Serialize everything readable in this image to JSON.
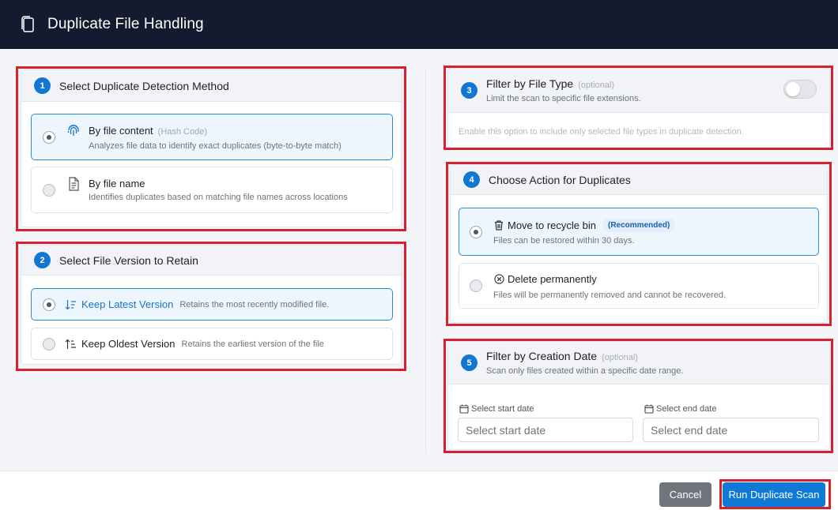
{
  "header": {
    "title": "Duplicate File Handling",
    "icon": "copy-icon"
  },
  "section1": {
    "step": "1",
    "title": "Select Duplicate Detection Method",
    "options": [
      {
        "title": "By file content",
        "hint": "(Hash Code)",
        "desc": "Analyzes file data to identify exact duplicates (byte-to-byte match)",
        "icon": "fingerprint-icon",
        "selected": true
      },
      {
        "title": "By file name",
        "desc": "Identifies duplicates based on matching file names across locations",
        "icon": "document-icon",
        "selected": false
      }
    ]
  },
  "section2": {
    "step": "2",
    "title": "Select File Version to Retain",
    "options": [
      {
        "title": "Keep Latest Version",
        "desc": "Retains the most recently modified file.",
        "icon": "sort-desc-icon",
        "selected": true
      },
      {
        "title": "Keep Oldest Version",
        "desc": "Retains the earliest version of the file",
        "icon": "sort-asc-icon",
        "selected": false
      }
    ]
  },
  "section3": {
    "step": "3",
    "title": "Filter by File Type",
    "optional": "(optional)",
    "subtitle": "Limit the scan to specific file extensions.",
    "body": "Enable this option to include only selected file types in duplicate detection.",
    "toggle_on": false
  },
  "section4": {
    "step": "4",
    "title": "Choose Action for Duplicates",
    "options": [
      {
        "title": "Move to recycle bin",
        "badge": "(Recommended)",
        "desc": "Files can be restored within 30 days.",
        "icon": "trash-icon",
        "selected": true
      },
      {
        "title": "Delete permanently",
        "desc": "Files will be permanently removed and cannot be recovered.",
        "icon": "circle-x-icon",
        "selected": false
      }
    ]
  },
  "section5": {
    "step": "5",
    "title": "Filter by Creation Date",
    "optional": "(optional)",
    "subtitle": "Scan only files created within a specific date range.",
    "start_label": "Select start date",
    "start_placeholder": "Select start date",
    "end_label": "Select end date",
    "end_placeholder": "Select end date"
  },
  "footer": {
    "cancel_label": "Cancel",
    "run_label": "Run Duplicate Scan"
  },
  "colors": {
    "header_bg": "#141b2e",
    "accent": "#0f7ad6",
    "highlight": "#d7202f"
  }
}
